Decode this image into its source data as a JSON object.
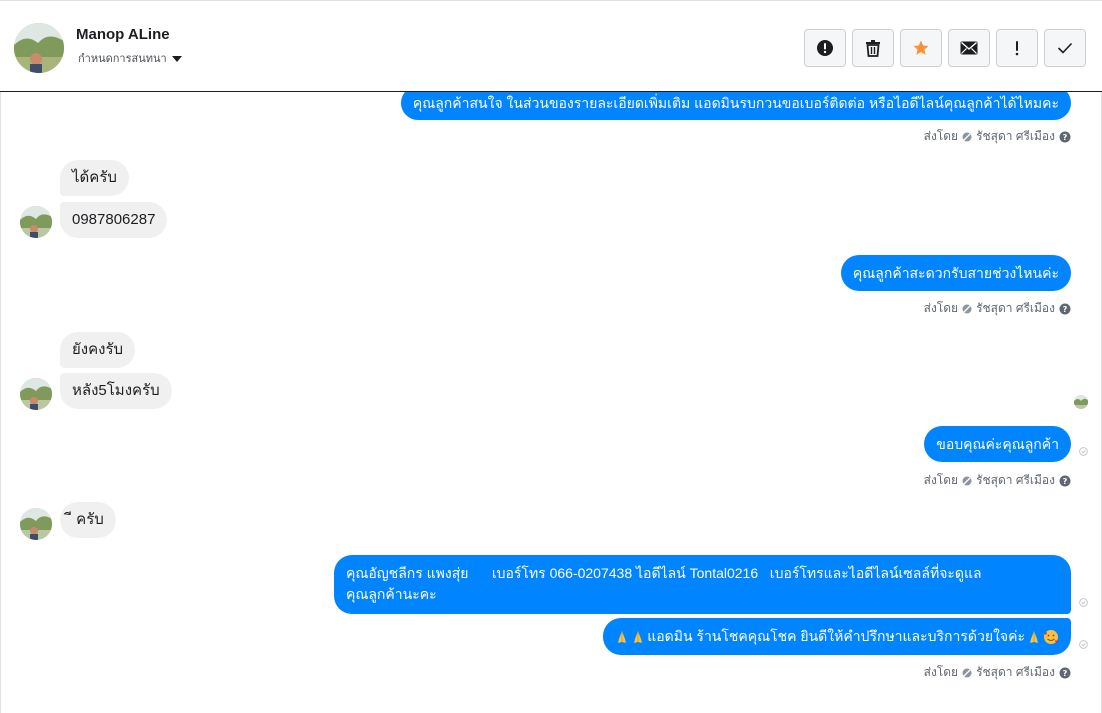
{
  "contact": {
    "name": "Manop ALine",
    "assign_label": "กำหนดการสนทนา"
  },
  "toolbar": [
    {
      "icon": "alert-circle-icon",
      "name": "spam-button"
    },
    {
      "icon": "trash-icon",
      "name": "delete-button"
    },
    {
      "icon": "star-icon",
      "name": "star-button"
    },
    {
      "icon": "envelope-icon",
      "name": "mark-unread-button"
    },
    {
      "icon": "exclamation-icon",
      "name": "follow-up-button"
    },
    {
      "icon": "check-icon",
      "name": "mark-done-button"
    }
  ],
  "colors": {
    "accent": "#0084ff",
    "star": "#f7923b",
    "incoming_bg": "#f0f0f0"
  },
  "messages": {
    "m1": "คุณลูกค้าสนใจ ในส่วนของรายละเอียดเพิ่มเติม แอดมินรบกวนขอเบอร์ติดต่อ หรือไอดีไลน์คุณลูกค้าได้ไหมคะ",
    "m2": "ได้ครับ",
    "m3": "0987806287",
    "m4": "คุณลูกค้าสะดวกรับสายช่วงไหนค่ะ",
    "m5": "ยังคงรับ",
    "m6": "หลัง5โมงครับ",
    "m7": "ขอบคุณค่ะคุณลูกค้า",
    "m8": "ี ครับ",
    "m9_line1": "คุณอัญชลีกร แพงสุ่ย      เบอร์โทร 066-0207438 ไอดีไลน์ Tontal0216   เบอร์โทรและไอดีไลน์เซลล์ที่จะดูแล",
    "m9_line2": "คุณลูกค้านะคะ",
    "m10": "แอดมิน ร้านโชคคุณโชค ยินดีให้คำปรึกษาและบริการด้วยใจค่ะ"
  },
  "sent_by": {
    "prefix": "ส่งโดย",
    "agent": "รัชสุดา ศรีเมือง"
  }
}
